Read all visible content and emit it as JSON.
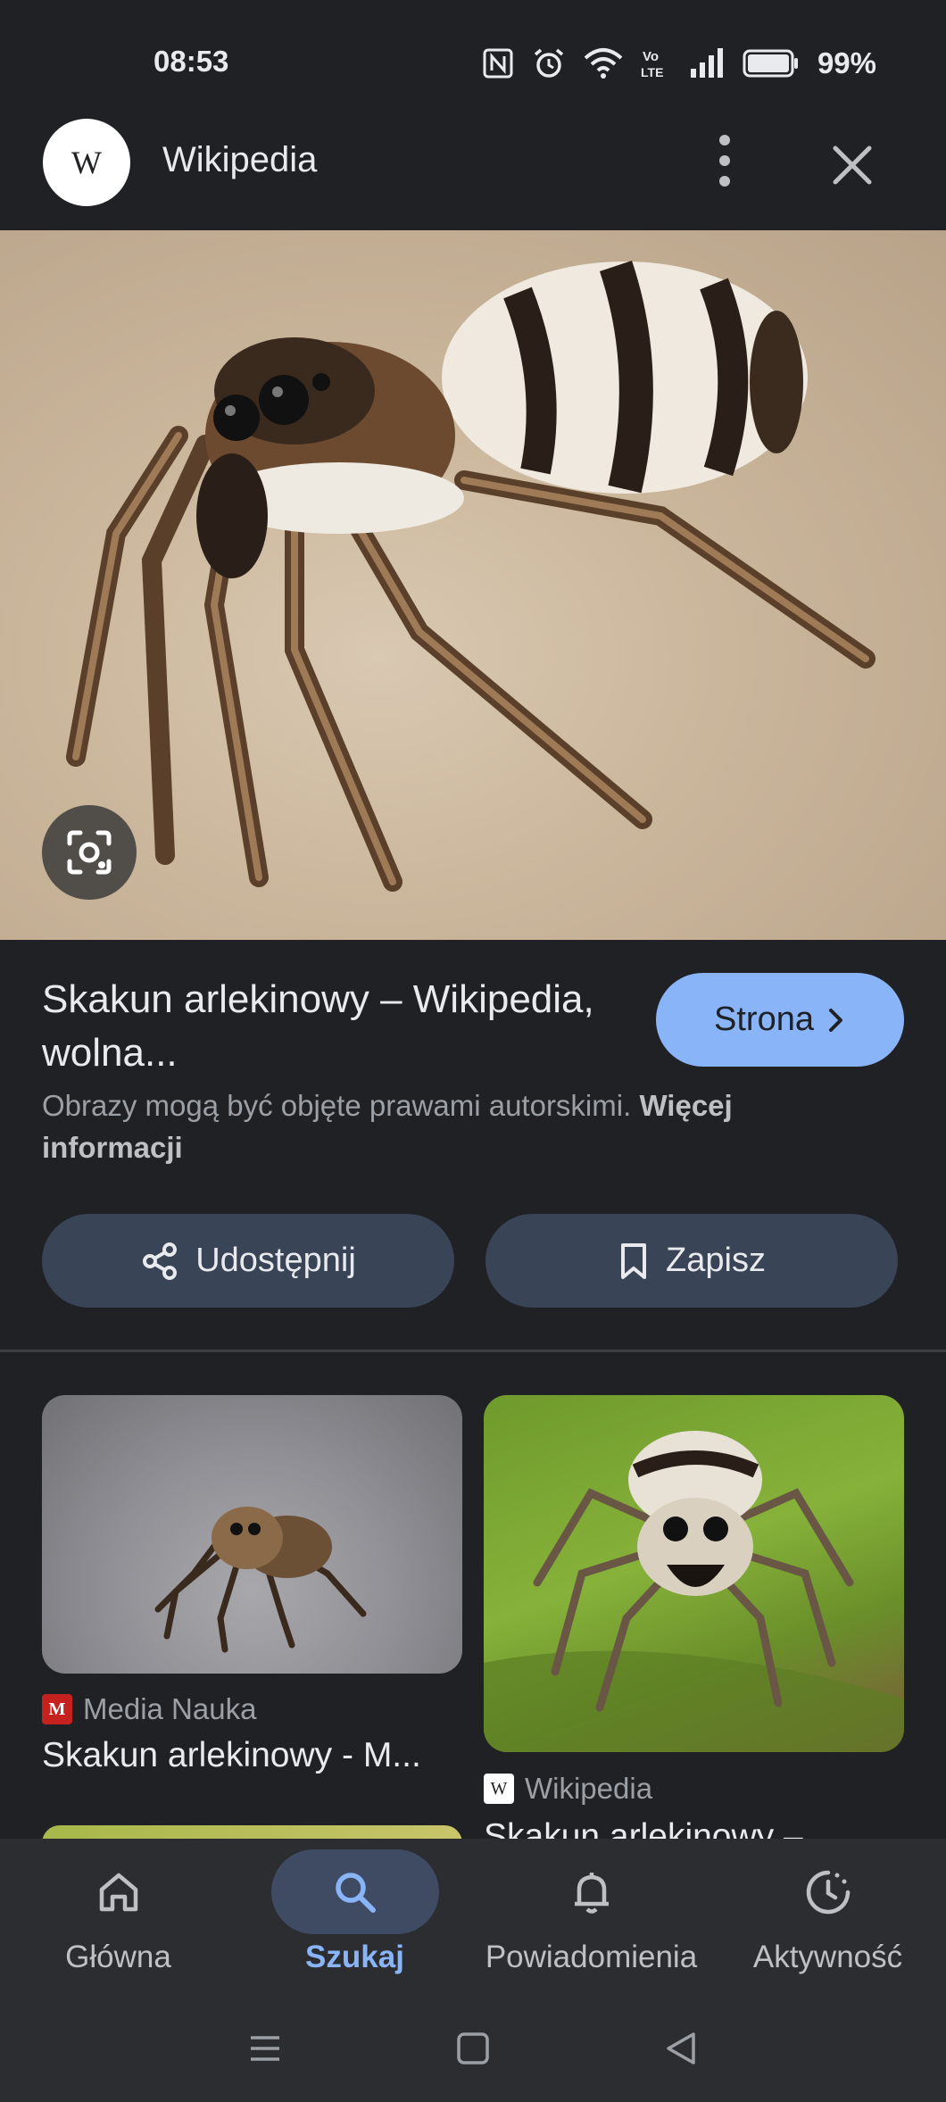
{
  "status_bar": {
    "time": "08:53",
    "battery": "99%",
    "icons": [
      "nfc-icon",
      "alarm-icon",
      "wifi-icon",
      "volte-icon",
      "signal-icon",
      "battery-icon"
    ]
  },
  "header": {
    "logo_letter": "W",
    "title": "Wikipedia",
    "icons": [
      "more-vert-icon",
      "close-icon"
    ]
  },
  "hero": {
    "lens_icon": "google-lens-icon"
  },
  "result": {
    "title": "Skakun arlekinowy – Wikipedia, wolna...",
    "visit_label": "Strona",
    "copyright_text": "Obrazy mogą być objęte prawami autorskimi.",
    "more_info_label": "Więcej informacji"
  },
  "actions": {
    "share_label": "Udostępnij",
    "save_label": "Zapisz"
  },
  "related": [
    {
      "source": "Media Nauka",
      "favicon_letter": "M",
      "title": "Skakun arlekinowy - M..."
    },
    {
      "source": "Wikipedia",
      "favicon_letter": "W",
      "title": "Skakun arlekinowy –"
    }
  ],
  "bottom_nav": {
    "items": [
      {
        "label": "Główna",
        "icon": "home-icon",
        "active": false
      },
      {
        "label": "Szukaj",
        "icon": "search-icon",
        "active": true
      },
      {
        "label": "Powiadomienia",
        "icon": "bell-icon",
        "active": false
      },
      {
        "label": "Aktywność",
        "icon": "activity-icon",
        "active": false
      }
    ]
  },
  "colors": {
    "background": "#202124",
    "accent": "#8ab4f8",
    "button_bg": "#394457",
    "nav_bg": "#2b2d31"
  }
}
